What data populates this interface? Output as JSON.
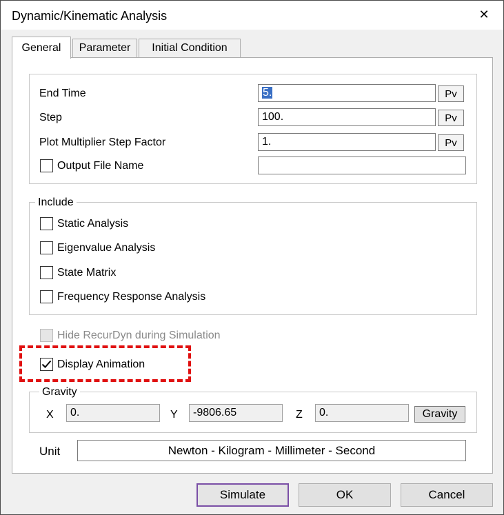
{
  "window": {
    "title": "Dynamic/Kinematic Analysis",
    "close_glyph": "✕"
  },
  "tabs": [
    {
      "label": "General"
    },
    {
      "label": "Parameter"
    },
    {
      "label": "Initial Condition"
    }
  ],
  "time_settings": {
    "end_time_label": "End Time",
    "end_time_value": "5.",
    "step_label": "Step",
    "step_value": "100.",
    "plot_multiplier_label": "Plot Multiplier Step Factor",
    "plot_multiplier_value": "1.",
    "pv_label": "Pv",
    "output_file_label": "Output File Name",
    "output_file_value": "",
    "output_file_checked": false
  },
  "include": {
    "caption": "Include",
    "items": [
      {
        "label": "Static Analysis",
        "checked": false
      },
      {
        "label": "Eigenvalue Analysis",
        "checked": false
      },
      {
        "label": "State Matrix",
        "checked": false
      },
      {
        "label": "Frequency Response Analysis",
        "checked": false
      }
    ]
  },
  "options": {
    "hide_recurdyn_label": "Hide RecurDyn during Simulation",
    "hide_recurdyn_checked": false,
    "display_animation_label": "Display Animation",
    "display_animation_checked": true
  },
  "gravity": {
    "caption": "Gravity",
    "x_label": "X",
    "x_value": "0.",
    "y_label": "Y",
    "y_value": "-9806.65",
    "z_label": "Z",
    "z_value": "0.",
    "button_label": "Gravity"
  },
  "unit": {
    "label": "Unit",
    "value": "Newton - Kilogram - Millimeter - Second"
  },
  "footer": {
    "simulate_label": "Simulate",
    "ok_label": "OK",
    "cancel_label": "Cancel"
  },
  "colors": {
    "annotation_outline": "#e01010",
    "selection": "#3a6fc4",
    "default_button_border": "#7a4fa6"
  }
}
